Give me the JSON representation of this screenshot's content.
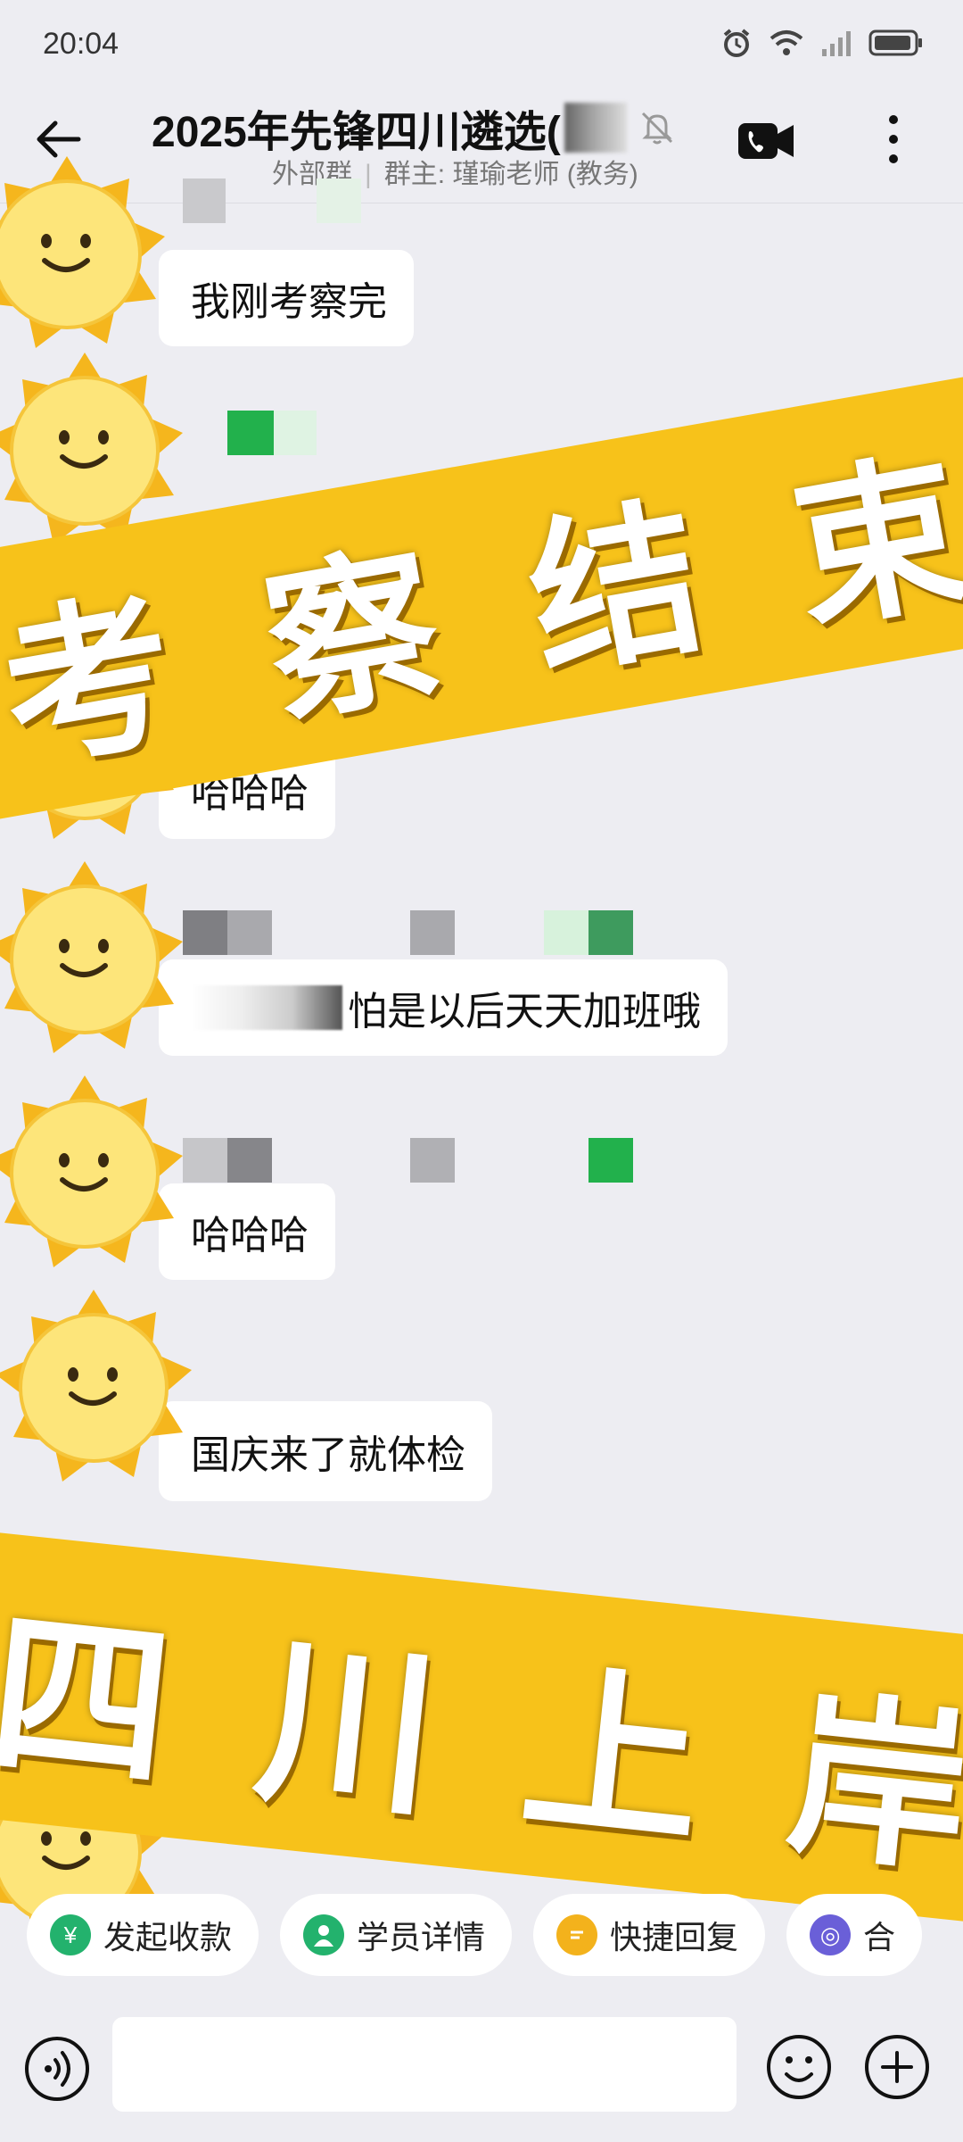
{
  "status_bar": {
    "time": "20:04",
    "icons": [
      "alarm-icon",
      "wifi-icon",
      "signal-icon",
      "battery-icon"
    ]
  },
  "header": {
    "back_icon": "back-arrow-icon",
    "title": "2025年先锋四川遴选(",
    "mute_icon": "bell-off-icon",
    "group_type": "外部群",
    "group_owner": "群主: 瑾瑜老师 (教务)",
    "video_call_icon": "video-call-icon",
    "more_icon": "more-vertical-icon"
  },
  "messages": [
    {
      "text": "我刚考察完"
    },
    {
      "text": "哈哈哈"
    },
    {
      "text": "怕是以后天天加班哦"
    },
    {
      "text": "哈哈哈"
    },
    {
      "text": "国庆来了就体检"
    }
  ],
  "banners": {
    "top": [
      "考",
      "察",
      "结",
      "束"
    ],
    "bottom": [
      "四",
      "川",
      "上",
      "岸"
    ]
  },
  "quick_actions": [
    {
      "label": "发起收款",
      "icon": "yuan-icon",
      "color": "#23b26d"
    },
    {
      "label": "学员详情",
      "icon": "user-icon",
      "color": "#23b26d"
    },
    {
      "label": "快捷回复",
      "icon": "quick-reply-icon",
      "color": "#f3b21c"
    },
    {
      "label": "合",
      "icon": "merge-icon",
      "color": "#6a5fd8"
    }
  ],
  "input_bar": {
    "voice_icon": "voice-icon",
    "placeholder": "",
    "emoji_icon": "emoji-icon",
    "plus_icon": "plus-icon"
  },
  "colors": {
    "banner": "#f7c21a",
    "background": "#ededf2",
    "accent_green": "#23b26d"
  }
}
